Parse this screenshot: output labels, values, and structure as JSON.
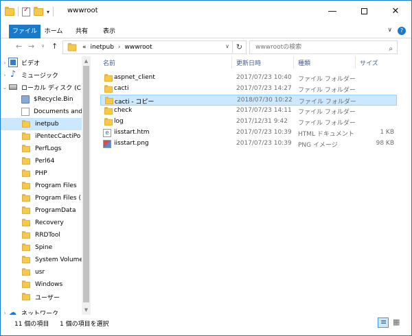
{
  "window": {
    "title": "wwwroot"
  },
  "titlebar": {
    "minimize": "—",
    "close": "✕"
  },
  "ribbon": {
    "tabs": [
      {
        "label": "ファイル"
      },
      {
        "label": "ホーム"
      },
      {
        "label": "共有"
      },
      {
        "label": "表示"
      }
    ],
    "expand": "∨",
    "help": "?"
  },
  "address": {
    "overflow": "«",
    "crumbs": [
      "inetpub",
      "wwwroot"
    ],
    "separator": "›",
    "search_placeholder": "wwwrootの検索"
  },
  "columns": {
    "name": "名前",
    "date": "更新日時",
    "type": "種類",
    "size": "サイズ"
  },
  "nav": {
    "items": [
      {
        "label": "ビデオ",
        "icon": "video-icon"
      },
      {
        "label": "ミュージック",
        "icon": "music-icon"
      },
      {
        "label": "ローカル ディスク (C",
        "icon": "drive-icon"
      },
      {
        "label": "$Recycle.Bin",
        "icon": "recycle-bin-icon"
      },
      {
        "label": "Documents and",
        "icon": "documents-icon"
      },
      {
        "label": "inetpub",
        "icon": "folder-icon",
        "selected": true
      },
      {
        "label": "iPentecCactiPo",
        "icon": "folder-icon"
      },
      {
        "label": "PerfLogs",
        "icon": "folder-icon"
      },
      {
        "label": "Perl64",
        "icon": "folder-icon"
      },
      {
        "label": "PHP",
        "icon": "folder-icon"
      },
      {
        "label": "Program Files",
        "icon": "folder-icon"
      },
      {
        "label": "Program Files (",
        "icon": "folder-icon"
      },
      {
        "label": "ProgramData",
        "icon": "folder-icon"
      },
      {
        "label": "Recovery",
        "icon": "folder-icon"
      },
      {
        "label": "RRDTool",
        "icon": "folder-icon"
      },
      {
        "label": "Spine",
        "icon": "folder-icon"
      },
      {
        "label": "System Volume",
        "icon": "folder-icon"
      },
      {
        "label": "usr",
        "icon": "folder-icon"
      },
      {
        "label": "Windows",
        "icon": "folder-icon"
      },
      {
        "label": "ユーザー",
        "icon": "folder-icon"
      },
      {
        "label": "ネットワーク",
        "icon": "network-icon"
      }
    ]
  },
  "files": [
    {
      "name": "aspnet_client",
      "date": "2017/07/23 10:40",
      "type": "ファイル フォルダー",
      "size": "",
      "icon": "folder-icon"
    },
    {
      "name": "cacti",
      "date": "2017/07/23 14:27",
      "type": "ファイル フォルダー",
      "size": "",
      "icon": "folder-icon"
    },
    {
      "name": "cacti - コピー",
      "date": "2018/07/30 10:22",
      "type": "ファイル フォルダー",
      "size": "",
      "icon": "folder-icon",
      "selected": true
    },
    {
      "name": "check",
      "date": "2017/07/23 14:11",
      "type": "ファイル フォルダー",
      "size": "",
      "icon": "folder-icon"
    },
    {
      "name": "log",
      "date": "2017/12/31 9:42",
      "type": "ファイル フォルダー",
      "size": "",
      "icon": "folder-icon"
    },
    {
      "name": "iisstart.htm",
      "date": "2017/07/23 10:39",
      "type": "HTML ドキュメント",
      "size": "1 KB",
      "icon": "html-file-icon"
    },
    {
      "name": "iisstart.png",
      "date": "2017/07/23 10:39",
      "type": "PNG イメージ",
      "size": "98 KB",
      "icon": "png-file-icon"
    }
  ],
  "status": {
    "count": "11 個の項目",
    "selection": "1 個の項目を選択"
  },
  "colors": {
    "accent": "#1979ca",
    "selection": "#cce8ff",
    "folder": "#f6c94a"
  }
}
